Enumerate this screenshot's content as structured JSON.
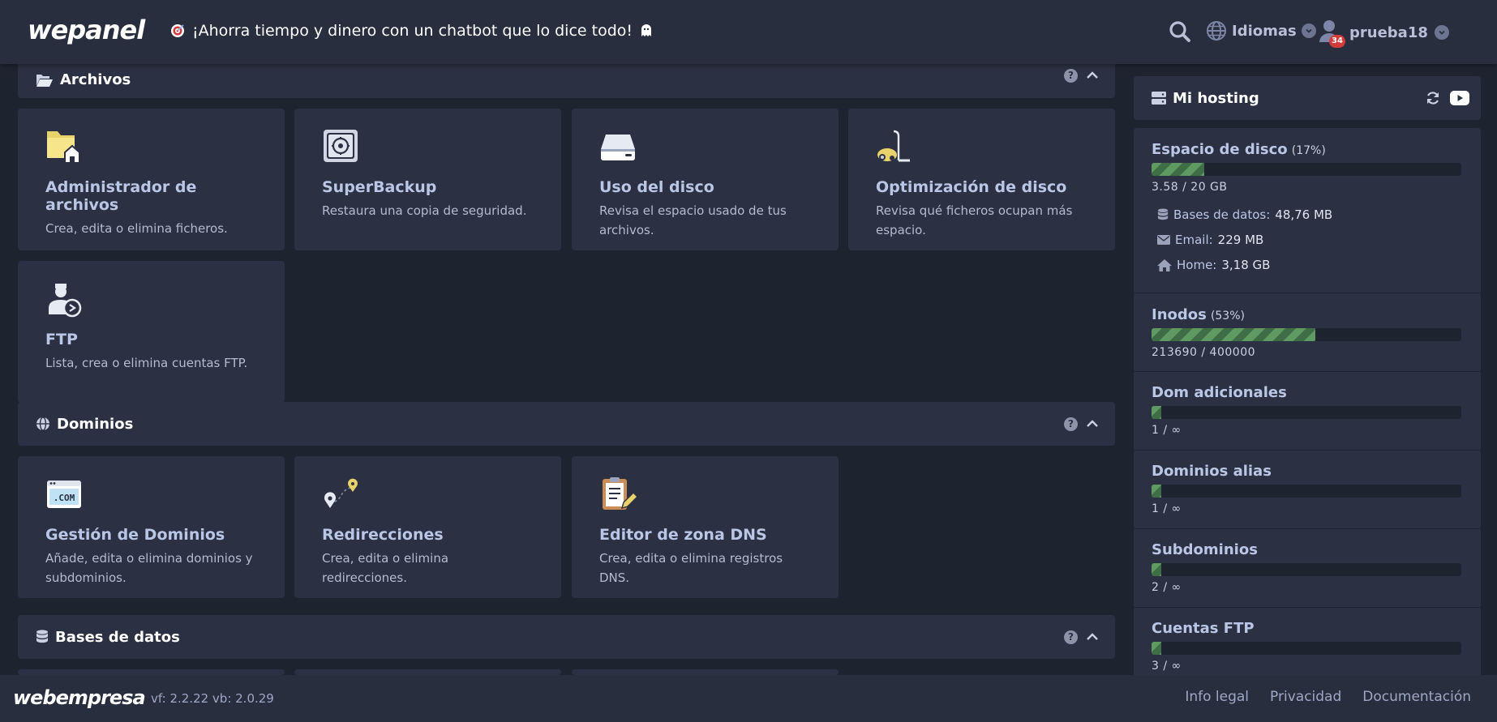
{
  "header": {
    "logo": "wepanel",
    "promo_text": "¡Ahorra tiempo y dinero con un chatbot que lo dice todo!",
    "language_label": "Idiomas",
    "username": "prueba18",
    "notification_count": "34"
  },
  "sections": {
    "archivos": {
      "title": "Archivos",
      "cards": [
        {
          "title": "Administrador de archivos",
          "desc": "Crea, edita o elimina ficheros.",
          "icon": "folder-home-icon"
        },
        {
          "title": "SuperBackup",
          "desc": "Restaura una copia de seguridad.",
          "icon": "safe-icon"
        },
        {
          "title": "Uso del disco",
          "desc": "Revisa el espacio usado de tus archivos.",
          "icon": "hard-drive-icon"
        },
        {
          "title": "Optimización de disco",
          "desc": "Revisa qué ficheros ocupan más espacio.",
          "icon": "vacuum-icon"
        },
        {
          "title": "FTP",
          "desc": "Lista, crea o elimina cuentas FTP.",
          "icon": "ftp-user-icon"
        }
      ]
    },
    "dominios": {
      "title": "Dominios",
      "cards": [
        {
          "title": "Gestión de Dominios",
          "desc": "Añade, edita o elimina dominios y subdominios.",
          "icon": "dotcom-icon"
        },
        {
          "title": "Redirecciones",
          "desc": "Crea, edita o elimina redirecciones.",
          "icon": "route-pins-icon"
        },
        {
          "title": "Editor de zona DNS",
          "desc": "Crea, edita o elimina registros DNS.",
          "icon": "clipboard-pencil-icon"
        }
      ]
    },
    "bases_datos": {
      "title": "Bases de datos"
    }
  },
  "sidebar": {
    "title": "Mi hosting",
    "disk": {
      "name": "Espacio de disco",
      "pct_label": "(17%)",
      "pct": 17,
      "value": "3.58 / 20 GB",
      "breakdown": [
        {
          "label": "Bases de datos:",
          "value": "48,76 MB",
          "icon": "database-icon"
        },
        {
          "label": "Email:",
          "value": "229 MB",
          "icon": "envelope-icon"
        },
        {
          "label": "Home:",
          "value": "3,18 GB",
          "icon": "home-icon"
        }
      ]
    },
    "metrics": [
      {
        "name": "Inodos",
        "pct_label": "(53%)",
        "pct": 53,
        "value": "213690 / 400000"
      },
      {
        "name": "Dom adicionales",
        "pct_label": "",
        "pct": 1,
        "value": "1 / ∞"
      },
      {
        "name": "Dominios alias",
        "pct_label": "",
        "pct": 1,
        "value": "1 / ∞"
      },
      {
        "name": "Subdominios",
        "pct_label": "",
        "pct": 1,
        "value": "2 / ∞"
      },
      {
        "name": "Cuentas FTP",
        "pct_label": "",
        "pct": 1,
        "value": "3 / ∞"
      }
    ]
  },
  "footer": {
    "logo": "webempresa",
    "version": "vf: 2.2.22 vb: 2.0.29",
    "links": [
      "Info legal",
      "Privacidad",
      "Documentación"
    ]
  },
  "colors": {
    "background": "#1e2330",
    "panel": "#2b3142",
    "header": "#282e3e",
    "bar_fill": "#5f9a62",
    "badge": "#d33b3b"
  }
}
